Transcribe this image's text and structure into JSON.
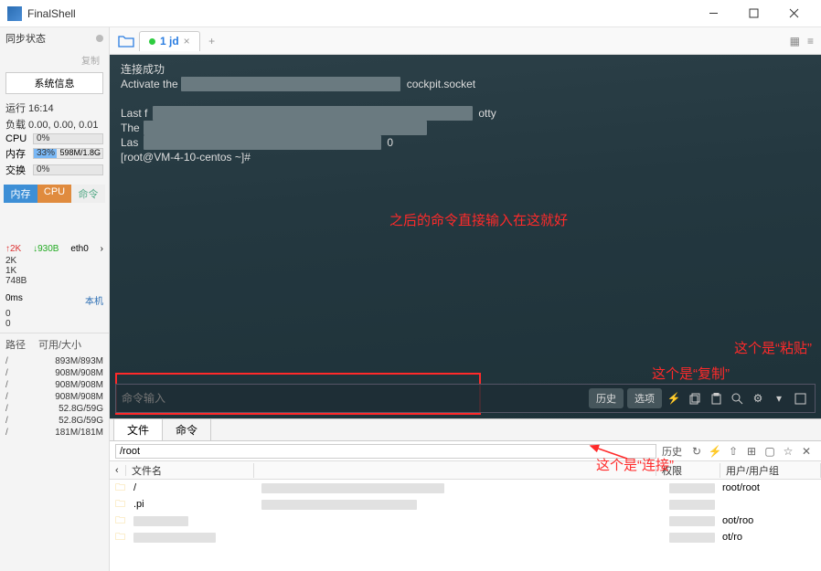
{
  "window": {
    "title": "FinalShell"
  },
  "sidebar": {
    "sync_label": "同步状态",
    "copy_label": "复制",
    "sysinfo_btn": "系统信息",
    "runtime": "运行 16:14",
    "load_label": "负载 0.00, 0.00, 0.01",
    "cpu_label": "CPU",
    "cpu_pct": "0%",
    "mem_label": "内存",
    "mem_pct": "33%",
    "mem_val": "598M/1.8G",
    "swap_label": "交换",
    "swap_pct": "0%",
    "tabs": {
      "t1": "内存",
      "t2": "CPU",
      "t3": "命令"
    },
    "net": {
      "up": "↑2K",
      "down": "↓930B",
      "iface": "eth0",
      "v1": "2K",
      "v2": "1K",
      "v3": "748B"
    },
    "lat": {
      "ms": "0ms",
      "host": "本机",
      "v1": "0",
      "v2": "0"
    },
    "path_col1": "路径",
    "path_col2": "可用/大小",
    "disks": [
      {
        "p": "/",
        "v": "893M/893M"
      },
      {
        "p": "/",
        "v": "908M/908M"
      },
      {
        "p": "/",
        "v": "908M/908M"
      },
      {
        "p": "/",
        "v": "908M/908M"
      },
      {
        "p": "/",
        "v": "52.8G/59G"
      },
      {
        "p": "/",
        "v": "52.8G/59G"
      },
      {
        "p": "/",
        "v": "181M/181M"
      }
    ]
  },
  "tabbar": {
    "tab1": "1 jd",
    "close": "×",
    "plus": "+"
  },
  "terminal": {
    "l1": "连接成功",
    "l2a": "Activate the ",
    "l2b": "  cockpit.socket",
    "l3": "Last f",
    "l3b": "otty",
    "l4": "The",
    "l5": "Las",
    "l5b": "0",
    "l6": "[root@VM-4-10-centos ~]#",
    "cmd_placeholder": "命令输入",
    "history": "历史",
    "options": "选项"
  },
  "annotations": {
    "main": "之后的命令直接输入在这就好",
    "copy": "这个是“复制”",
    "paste": "这个是“粘贴”",
    "connect": "这个是“连接”"
  },
  "lower": {
    "tab_file": "文件",
    "tab_cmd": "命令",
    "path": "/root",
    "history": "历史",
    "col_name": "文件名",
    "col_perm": "权限",
    "col_owner": "用户/用户组",
    "root_dir": "/",
    "rows": [
      {
        "name": ".pi",
        "owner": "root/root"
      },
      {
        "name": "",
        "owner": ""
      },
      {
        "name": "",
        "owner": "oot/roo"
      },
      {
        "name": "",
        "owner": "ot/ro"
      }
    ]
  }
}
